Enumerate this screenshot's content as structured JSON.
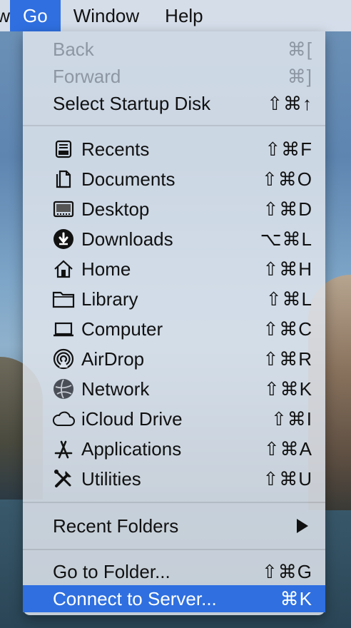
{
  "menubar": {
    "partial_left": "w",
    "items": [
      "Go",
      "Window",
      "Help"
    ]
  },
  "menu": {
    "top_items": [
      {
        "label": "Back",
        "shortcut": "⌘[",
        "disabled": true
      },
      {
        "label": "Forward",
        "shortcut": "⌘]",
        "disabled": true
      },
      {
        "label": "Select Startup Disk",
        "shortcut": "⇧⌘↑",
        "disabled": false
      }
    ],
    "places": [
      {
        "label": "Recents",
        "shortcut": "⇧⌘F",
        "icon": "recents-icon"
      },
      {
        "label": "Documents",
        "shortcut": "⇧⌘O",
        "icon": "documents-icon"
      },
      {
        "label": "Desktop",
        "shortcut": "⇧⌘D",
        "icon": "desktop-icon"
      },
      {
        "label": "Downloads",
        "shortcut": "⌥⌘L",
        "icon": "downloads-icon"
      },
      {
        "label": "Home",
        "shortcut": "⇧⌘H",
        "icon": "home-icon"
      },
      {
        "label": "Library",
        "shortcut": "⇧⌘L",
        "icon": "library-icon"
      },
      {
        "label": "Computer",
        "shortcut": "⇧⌘C",
        "icon": "computer-icon"
      },
      {
        "label": "AirDrop",
        "shortcut": "⇧⌘R",
        "icon": "airdrop-icon"
      },
      {
        "label": "Network",
        "shortcut": "⇧⌘K",
        "icon": "network-icon"
      },
      {
        "label": "iCloud Drive",
        "shortcut": "⇧⌘I",
        "icon": "icloud-icon"
      },
      {
        "label": "Applications",
        "shortcut": "⇧⌘A",
        "icon": "applications-icon"
      },
      {
        "label": "Utilities",
        "shortcut": "⇧⌘U",
        "icon": "utilities-icon"
      }
    ],
    "recent_folders": {
      "label": "Recent Folders"
    },
    "bottom_items": [
      {
        "label": "Go to Folder...",
        "shortcut": "⇧⌘G",
        "selected": false
      },
      {
        "label": "Connect to Server...",
        "shortcut": "⌘K",
        "selected": true
      }
    ]
  },
  "colors": {
    "highlight": "#2f6fe0",
    "disabled_text": "#8d96a3"
  }
}
